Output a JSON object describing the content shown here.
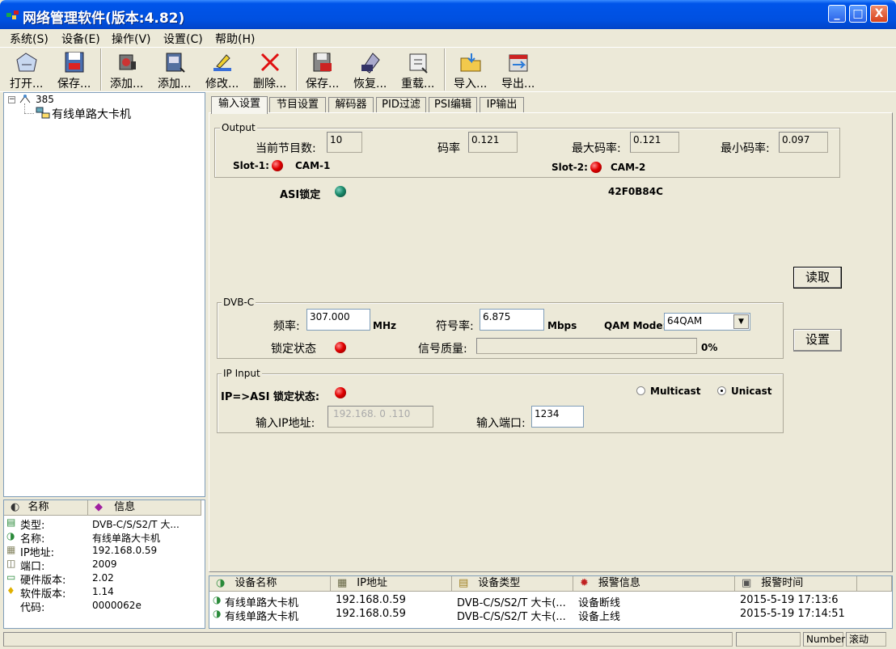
{
  "window": {
    "title": "网络管理软件(版本:4.82)",
    "minimize": "_",
    "maximize": "□",
    "close": "X"
  },
  "menu": [
    "系统(S)",
    "设备(E)",
    "操作(V)",
    "设置(C)",
    "帮助(H)"
  ],
  "toolbar": [
    {
      "label": "打开...",
      "icon": "open-icon"
    },
    {
      "label": "保存...",
      "icon": "save-icon"
    },
    {
      "label": "添加...",
      "icon": "add-device-icon"
    },
    {
      "label": "添加...",
      "icon": "add-item-icon"
    },
    {
      "label": "修改...",
      "icon": "edit-icon"
    },
    {
      "label": "删除...",
      "icon": "delete-icon"
    },
    {
      "label": "保存...",
      "icon": "save-config-icon"
    },
    {
      "label": "恢复...",
      "icon": "restore-icon"
    },
    {
      "label": "重载...",
      "icon": "reload-icon"
    },
    {
      "label": "导入...",
      "icon": "import-icon"
    },
    {
      "label": "导出...",
      "icon": "export-icon"
    }
  ],
  "tree": {
    "root": "385",
    "child": "有线单路大卡机"
  },
  "info_panel": {
    "headers": {
      "name": "名称",
      "info": "信息"
    },
    "rows": [
      {
        "label": "类型:",
        "value": "DVB-C/S/S2/T 大..."
      },
      {
        "label": "名称:",
        "value": "有线单路大卡机"
      },
      {
        "label": "IP地址:",
        "value": "192.168.0.59"
      },
      {
        "label": "端口:",
        "value": "2009"
      },
      {
        "label": "硬件版本:",
        "value": "2.02"
      },
      {
        "label": "软件版本:",
        "value": "1.14"
      },
      {
        "label": "代码:",
        "value": "0000062e"
      }
    ]
  },
  "tabs": [
    "输入设置",
    "节目设置",
    "解码器",
    "PID过滤",
    "PSI编辑",
    "IP输出"
  ],
  "output": {
    "title": "Output",
    "programs_label": "当前节目数:",
    "programs": "10",
    "rate_label": "码率",
    "rate": "0.121",
    "max_rate_label": "最大码率:",
    "max_rate": "0.121",
    "min_rate_label": "最小码率:",
    "min_rate": "0.097",
    "slot1_label": "Slot-1:",
    "slot1_value": "CAM-1",
    "slot2_label": "Slot-2:",
    "slot2_value": "CAM-2"
  },
  "asi": {
    "label": "ASI锁定",
    "code": "42F0B84C"
  },
  "read_button": "读取",
  "set_button": "设置",
  "dvbc": {
    "title": "DVB-C",
    "freq_label": "频率:",
    "freq": "307.000",
    "freq_unit": "MHz",
    "symbol_label": "符号率:",
    "symbol": "6.875",
    "symbol_unit": "Mbps",
    "qam_label": "QAM Mode:",
    "qam": "64QAM",
    "lock_label": "锁定状态",
    "quality_label": "信号质量:",
    "quality": "0%"
  },
  "ip_input": {
    "title": "IP Input",
    "lock_label": "IP=>ASI 锁定状态:",
    "multicast": "Multicast",
    "unicast": "Unicast",
    "ip_label": "输入IP地址:",
    "ip": "192.168. 0 .110",
    "port_label": "输入端口:",
    "port": "1234"
  },
  "alarm_table": {
    "headers": [
      "设备名称",
      "IP地址",
      "设备类型",
      "报警信息",
      "报警时间"
    ],
    "rows": [
      [
        "有线单路大卡机",
        "192.168.0.59",
        "DVB-C/S/S2/T 大卡(...",
        "设备断线",
        "2015-5-19 17:13:6"
      ],
      [
        "有线单路大卡机",
        "192.168.0.59",
        "DVB-C/S/S2/T 大卡(...",
        "设备上线",
        "2015-5-19 17:14:51"
      ]
    ]
  },
  "statusbar": {
    "number": "Number",
    "scroll": "滚动"
  }
}
